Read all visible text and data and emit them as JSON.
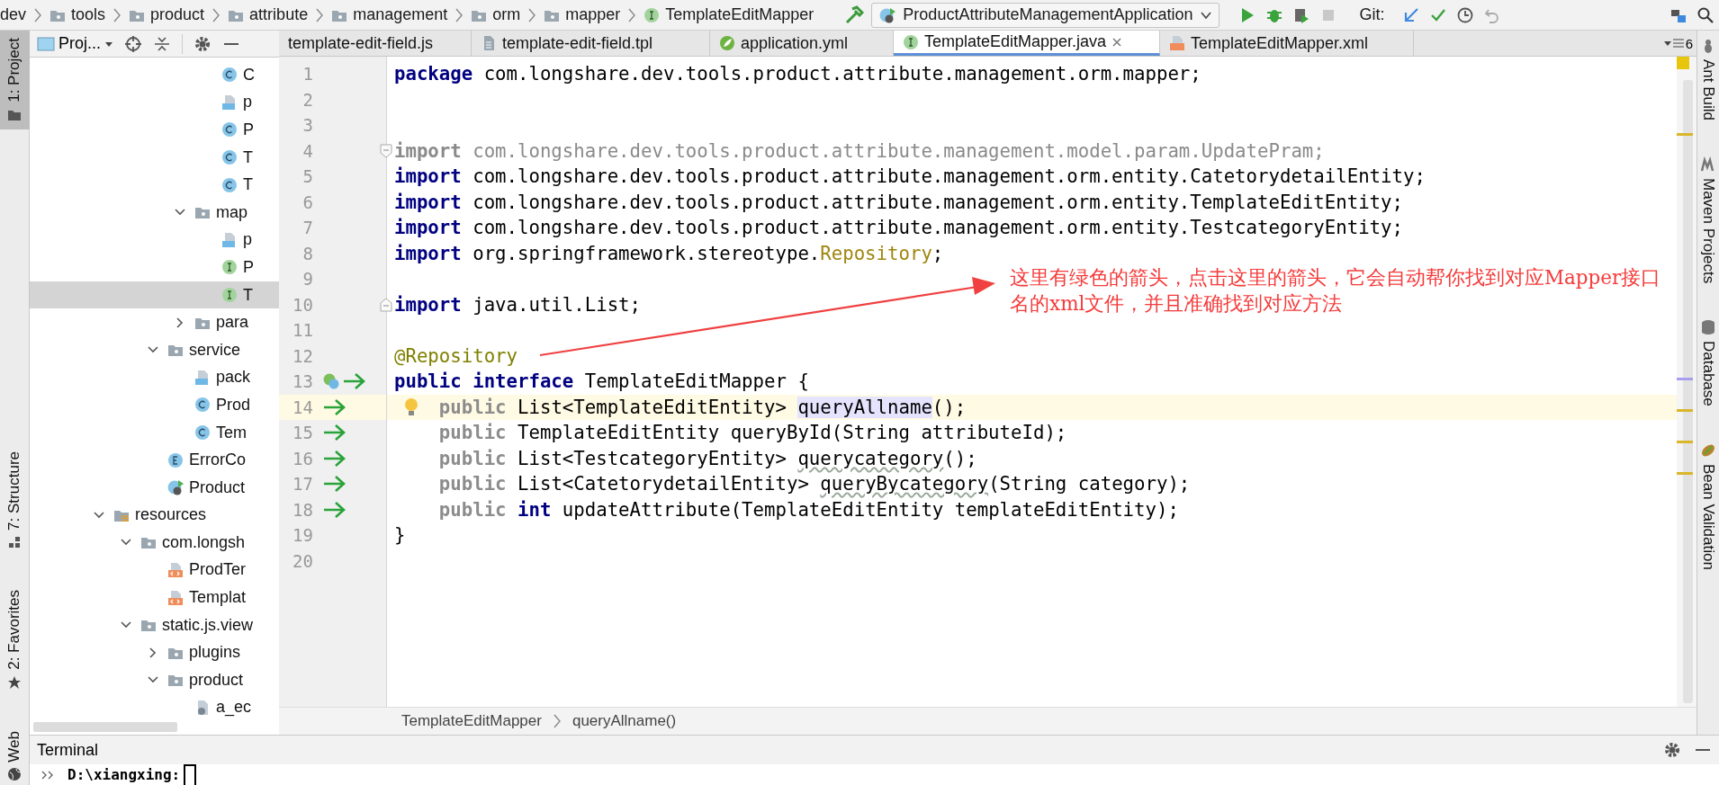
{
  "navbar": {
    "crumbs": [
      {
        "kind": "text",
        "label": "dev"
      },
      {
        "kind": "folder",
        "label": "tools"
      },
      {
        "kind": "folder",
        "label": "product"
      },
      {
        "kind": "folder",
        "label": "attribute"
      },
      {
        "kind": "folder",
        "label": "management"
      },
      {
        "kind": "folder",
        "label": "orm"
      },
      {
        "kind": "folder",
        "label": "mapper"
      },
      {
        "kind": "interface",
        "label": "TemplateEditMapper"
      }
    ],
    "run_config": "ProductAttributeManagementApplication",
    "vcs_label": "Git:"
  },
  "left_strip": [
    {
      "label": "1: Project",
      "kind": "project",
      "selected": true
    },
    {
      "label": "7: Structure",
      "kind": "structure",
      "selected": false
    },
    {
      "label": "2: Favorites",
      "kind": "favorites",
      "selected": false
    },
    {
      "label": "Web",
      "kind": "web",
      "selected": false
    }
  ],
  "project_panel": {
    "title": "Proj...",
    "tree": [
      {
        "children": [
          {
            "children": [
              {
                "children": [
                  {
                    "children": [
                      {
                        "kind": "class",
                        "label": "C",
                        "selected": false
                      },
                      {
                        "kind": "java-file",
                        "label": "p",
                        "selected": false
                      },
                      {
                        "kind": "class",
                        "label": "P",
                        "selected": false
                      },
                      {
                        "kind": "class",
                        "label": "T",
                        "selected": false
                      },
                      {
                        "kind": "class",
                        "label": "T",
                        "selected": false
                      }
                    ]
                  },
                  {
                    "kind": "folder",
                    "label": "map",
                    "expanded": true,
                    "selected": false,
                    "children": [
                      {
                        "kind": "java-file",
                        "label": "p",
                        "selected": false
                      },
                      {
                        "kind": "interface",
                        "label": "P",
                        "selected": false
                      },
                      {
                        "kind": "interface",
                        "label": "T",
                        "selected": true
                      }
                    ]
                  },
                  {
                    "kind": "folder",
                    "label": "para",
                    "expanded": false,
                    "selected": false
                  }
                ]
              },
              {
                "kind": "folder",
                "label": "service",
                "expanded": true,
                "selected": false,
                "children": [
                  {
                    "kind": "java-file",
                    "label": "pack",
                    "selected": false
                  },
                  {
                    "kind": "class",
                    "label": "Prod",
                    "selected": false
                  },
                  {
                    "kind": "class",
                    "label": "Tem",
                    "selected": false
                  }
                ]
              },
              {
                "kind": "enum",
                "label": "ErrorCo",
                "selected": false
              },
              {
                "kind": "boot-class",
                "label": "Product",
                "selected": false
              }
            ]
          }
        ]
      },
      {
        "kind": "resource-folder",
        "label": "resources",
        "expanded": true,
        "selected": false,
        "children": [
          {
            "kind": "folder",
            "label": "com.longsh",
            "expanded": true,
            "selected": false,
            "children": [
              {
                "kind": "xml-file",
                "label": "ProdTer",
                "selected": false
              },
              {
                "kind": "xml-file",
                "label": "Templat",
                "selected": false
              }
            ]
          },
          {
            "kind": "folder",
            "label": "static.js.view",
            "expanded": true,
            "selected": false,
            "children": [
              {
                "kind": "folder",
                "label": "plugins",
                "expanded": false,
                "selected": false
              },
              {
                "kind": "folder",
                "label": "product",
                "expanded": true,
                "selected": false,
                "children": [
                  {
                    "kind": "script-file",
                    "label": "a_ec",
                    "selected": false
                  }
                ]
              }
            ]
          }
        ]
      }
    ]
  },
  "editor_tabs": [
    {
      "kind": "js",
      "label": "template-edit-field.js",
      "selected": false
    },
    {
      "kind": "tpl",
      "label": "template-edit-field.tpl",
      "selected": false
    },
    {
      "kind": "yml",
      "label": "application.yml",
      "selected": false
    },
    {
      "kind": "interface",
      "label": "TemplateEditMapper.java",
      "selected": true
    },
    {
      "kind": "xml",
      "label": "TemplateEditMapper.xml",
      "selected": false
    }
  ],
  "tab_count": "6",
  "editor": {
    "lines": [
      {
        "number": "1",
        "tokens": [
          {
            "kind": "keyword",
            "text": "package"
          },
          {
            "kind": "plain",
            "text": " com.longshare.dev.tools.product.attribute.management.orm.mapper;"
          }
        ]
      },
      {
        "number": "2"
      },
      {
        "number": "3"
      },
      {
        "number": "4",
        "fold_start": true,
        "tokens": [
          {
            "kind": "muted-keyword",
            "text": "import"
          },
          {
            "kind": "muted",
            "text": " com.longshare.dev.tools.product.attribute.management.model.param.UpdatePram;"
          }
        ]
      },
      {
        "number": "5",
        "tokens": [
          {
            "kind": "keyword",
            "text": "import"
          },
          {
            "kind": "plain",
            "text": " com.longshare.dev.tools.product.attribute.management.orm.entity.CatetorydetailEntity;"
          }
        ]
      },
      {
        "number": "6",
        "tokens": [
          {
            "kind": "keyword",
            "text": "import"
          },
          {
            "kind": "plain",
            "text": " com.longshare.dev.tools.product.attribute.management.orm.entity.TemplateEditEntity;"
          }
        ]
      },
      {
        "number": "7",
        "tokens": [
          {
            "kind": "keyword",
            "text": "import"
          },
          {
            "kind": "plain",
            "text": " com.longshare.dev.tools.product.attribute.management.orm.entity.TestcategoryEntity;"
          }
        ]
      },
      {
        "number": "8",
        "tokens": [
          {
            "kind": "keyword",
            "text": "import"
          },
          {
            "kind": "plain",
            "text": " org.springframework.stereotype."
          },
          {
            "kind": "class-ref",
            "text": "Repository"
          },
          {
            "kind": "plain",
            "text": ";"
          }
        ]
      },
      {
        "number": "9"
      },
      {
        "number": "10",
        "fold_end": true,
        "tokens": [
          {
            "kind": "keyword",
            "text": "import"
          },
          {
            "kind": "plain",
            "text": " java.util.List;"
          }
        ]
      },
      {
        "number": "11"
      },
      {
        "number": "12",
        "tokens": [
          {
            "kind": "annotation",
            "text": "@Repository"
          }
        ]
      },
      {
        "number": "13",
        "bean_icon": true,
        "navigate_arrow": true,
        "tokens": [
          {
            "kind": "keyword",
            "text": "public "
          },
          {
            "kind": "keyword",
            "text": "interface"
          },
          {
            "kind": "plain",
            "text": " TemplateEditMapper {"
          }
        ]
      },
      {
        "number": "14",
        "navigate_arrow": true,
        "current": true,
        "bulb": true,
        "tokens": [
          {
            "kind": "redundant",
            "text": "    public"
          },
          {
            "kind": "plain",
            "text": " List<TemplateEditEntity> "
          },
          {
            "kind": "highlight",
            "text": "queryAllname"
          },
          {
            "kind": "plain",
            "text": "();"
          }
        ]
      },
      {
        "number": "15",
        "navigate_arrow": true,
        "tokens": [
          {
            "kind": "redundant",
            "text": "    public"
          },
          {
            "kind": "plain",
            "text": " TemplateEditEntity queryById(String attributeId);"
          }
        ]
      },
      {
        "number": "16",
        "navigate_arrow": true,
        "tokens": [
          {
            "kind": "redundant",
            "text": "    public"
          },
          {
            "kind": "plain",
            "text": " List<TestcategoryEntity> "
          },
          {
            "kind": "squiggle",
            "text": "querycategory"
          },
          {
            "kind": "plain",
            "text": "();"
          }
        ]
      },
      {
        "number": "17",
        "navigate_arrow": true,
        "tokens": [
          {
            "kind": "redundant",
            "text": "    public"
          },
          {
            "kind": "plain",
            "text": " List<CatetorydetailEntity> "
          },
          {
            "kind": "squiggle",
            "text": "queryBycategory"
          },
          {
            "kind": "plain",
            "text": "(String category);"
          }
        ]
      },
      {
        "number": "18",
        "navigate_arrow": true,
        "tokens": [
          {
            "kind": "redundant",
            "text": "    public "
          },
          {
            "kind": "keyword",
            "text": "int"
          },
          {
            "kind": "plain",
            "text": " updateAttribute(TemplateEditEntity templateEditEntity);"
          }
        ]
      },
      {
        "number": "19",
        "tokens": [
          {
            "kind": "plain",
            "text": "}"
          }
        ]
      },
      {
        "number": "20"
      }
    ],
    "breadcrumb": [
      "TemplateEditMapper",
      "queryAllname()"
    ]
  },
  "callout": {
    "text": "这里有绿色的箭头，点击这里的箭头，它会自动帮你找到对应Mapper接口名的xml文件，并且准确找到对应方法"
  },
  "right_strip": [
    {
      "label": "Ant Build",
      "kind": "ant"
    },
    {
      "label": "Maven Projects",
      "kind": "maven"
    },
    {
      "label": "Database",
      "kind": "database"
    },
    {
      "label": "Bean Validation",
      "kind": "bean"
    }
  ],
  "terminal": {
    "title": "Terminal",
    "prompt": "D:\\xiangxing:"
  }
}
